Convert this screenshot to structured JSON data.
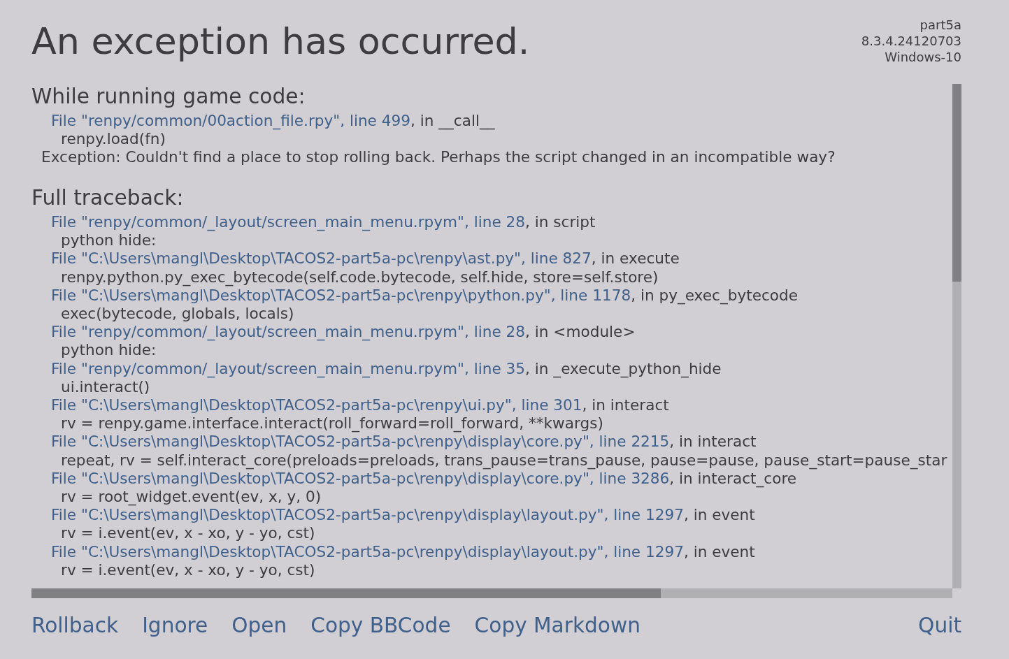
{
  "title": "An exception has occurred.",
  "build_info": [
    "part5a",
    "8.3.4.24120703",
    "Windows-10"
  ],
  "sections": [
    {
      "heading": "While running game code:",
      "lines": [
        {
          "kind": "frame",
          "link": "File \"renpy/common/00action_file.rpy\", line 499",
          "text": ", in __call__"
        },
        {
          "kind": "code",
          "text": "renpy.load(fn)"
        },
        {
          "kind": "exception",
          "text": "Exception: Couldn't find a place to stop rolling back. Perhaps the script changed in an incompatible way?"
        }
      ]
    },
    {
      "heading": "Full traceback:",
      "lines": [
        {
          "kind": "frame",
          "link": "File \"renpy/common/_layout/screen_main_menu.rpym\", line 28",
          "text": ", in script"
        },
        {
          "kind": "code",
          "text": "python hide:"
        },
        {
          "kind": "frame",
          "link": "File \"C:\\Users\\mangl\\Desktop\\TACOS2-part5a-pc\\renpy\\ast.py\", line 827",
          "text": ", in execute"
        },
        {
          "kind": "code",
          "text": "renpy.python.py_exec_bytecode(self.code.bytecode, self.hide, store=self.store)"
        },
        {
          "kind": "frame",
          "link": "File \"C:\\Users\\mangl\\Desktop\\TACOS2-part5a-pc\\renpy\\python.py\", line 1178",
          "text": ", in py_exec_bytecode"
        },
        {
          "kind": "code",
          "text": "exec(bytecode, globals, locals)"
        },
        {
          "kind": "frame",
          "link": "File \"renpy/common/_layout/screen_main_menu.rpym\", line 28",
          "text": ", in <module>"
        },
        {
          "kind": "code",
          "text": "python hide:"
        },
        {
          "kind": "frame",
          "link": "File \"renpy/common/_layout/screen_main_menu.rpym\", line 35",
          "text": ", in _execute_python_hide"
        },
        {
          "kind": "code",
          "text": "ui.interact()"
        },
        {
          "kind": "frame",
          "link": "File \"C:\\Users\\mangl\\Desktop\\TACOS2-part5a-pc\\renpy\\ui.py\", line 301",
          "text": ", in interact"
        },
        {
          "kind": "code",
          "text": "rv = renpy.game.interface.interact(roll_forward=roll_forward, **kwargs)"
        },
        {
          "kind": "frame",
          "link": "File \"C:\\Users\\mangl\\Desktop\\TACOS2-part5a-pc\\renpy\\display\\core.py\", line 2215",
          "text": ", in interact"
        },
        {
          "kind": "code",
          "text": "repeat, rv = self.interact_core(preloads=preloads, trans_pause=trans_pause, pause=pause, pause_start=pause_star"
        },
        {
          "kind": "frame",
          "link": "File \"C:\\Users\\mangl\\Desktop\\TACOS2-part5a-pc\\renpy\\display\\core.py\", line 3286",
          "text": ", in interact_core"
        },
        {
          "kind": "code",
          "text": "rv = root_widget.event(ev, x, y, 0)"
        },
        {
          "kind": "frame",
          "link": "File \"C:\\Users\\mangl\\Desktop\\TACOS2-part5a-pc\\renpy\\display\\layout.py\", line 1297",
          "text": ", in event"
        },
        {
          "kind": "code",
          "text": "rv = i.event(ev, x - xo, y - yo, cst)"
        },
        {
          "kind": "frame",
          "link": "File \"C:\\Users\\mangl\\Desktop\\TACOS2-part5a-pc\\renpy\\display\\layout.py\", line 1297",
          "text": ", in event"
        },
        {
          "kind": "code",
          "text": "rv = i.event(ev, x - xo, y - yo, cst)"
        }
      ]
    }
  ],
  "actions": [
    "Rollback",
    "Ignore",
    "Open",
    "Copy BBCode",
    "Copy Markdown"
  ],
  "quit": "Quit"
}
